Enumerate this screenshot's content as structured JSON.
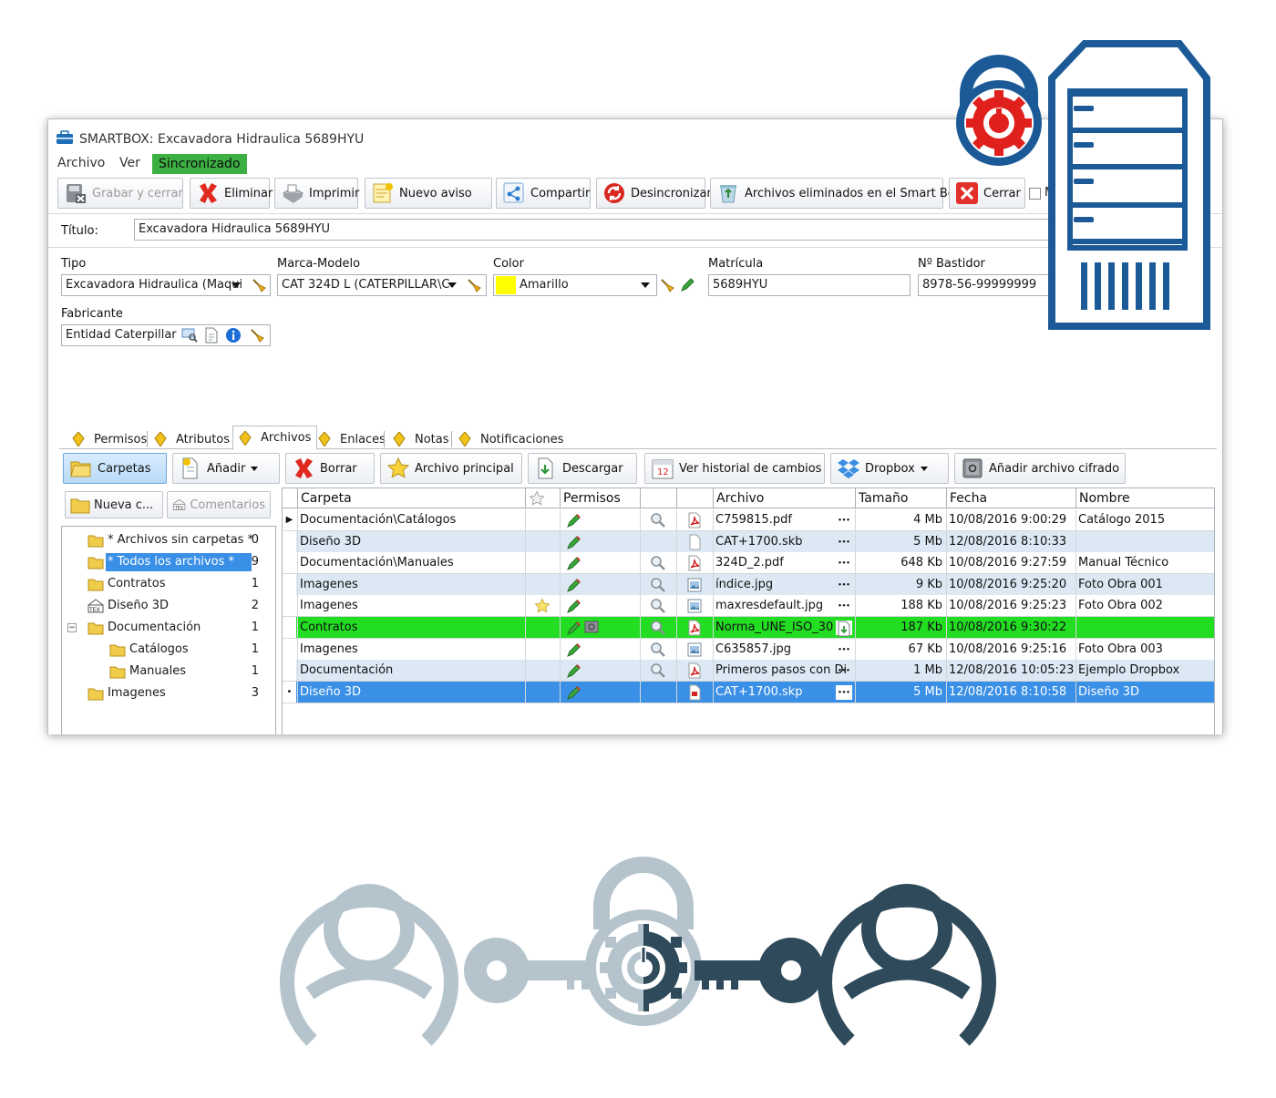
{
  "window": {
    "title": "SMARTBOX: Excavadora Hidraulica 5689HYU",
    "menu": [
      "Archivo",
      "Ver"
    ],
    "sync_label": "Sincronizado"
  },
  "toolbar": {
    "grabar": "Grabar y cerrar",
    "eliminar": "Eliminar",
    "imprimir": "Imprimir",
    "nuevo_aviso": "Nuevo aviso",
    "compartir": "Compartir",
    "desincronizar": "Desincronizar",
    "archivos_eliminados": "Archivos eliminados en el Smart Box",
    "cerrar": "Cerrar",
    "cerrar_check": "Ma"
  },
  "form": {
    "titulo_label": "Título:",
    "titulo_value": "Excavadora Hidraulica 5689HYU",
    "tipo_label": "Tipo",
    "tipo_value": "Excavadora Hidraulica (Maqui",
    "marca_label": "Marca-Modelo",
    "marca_value": "CAT 324D L (CATERPILLAR\\C",
    "color_label": "Color",
    "color_value": "Amarillo",
    "color_swatch": "#ffff00",
    "matricula_label": "Matrícula",
    "matricula_value": "5689HYU",
    "bastidor_label": "Nº Bastidor",
    "bastidor_value": "8978-56-99999999",
    "fabricante_label": "Fabricante",
    "fabricante_value": "Entidad Caterpillar"
  },
  "tabs": [
    "Permisos",
    "Atributos",
    "Archivos",
    "Enlaces",
    "Notas",
    "Notificaciones"
  ],
  "toolbar2": {
    "carpetas": "Carpetas",
    "anadir": "Añadir",
    "borrar": "Borrar",
    "archivo_principal": "Archivo principal",
    "descargar": "Descargar",
    "historial": "Ver historial de cambios",
    "dropbox": "Dropbox",
    "cifrado": "Añadir archivo cifrado"
  },
  "folder_buttons": {
    "nueva": "Nueva c...",
    "comentarios": "Comentarios"
  },
  "folders": [
    {
      "name": "* Archivos sin carpetas *",
      "count": "0"
    },
    {
      "name": "* Todos los archivos *",
      "count": "9"
    },
    {
      "name": "Contratos",
      "count": "1"
    },
    {
      "name": "Diseño 3D",
      "count": "2"
    },
    {
      "name": "Documentación",
      "count": "1"
    },
    {
      "name": "Catálogos",
      "count": "1"
    },
    {
      "name": "Manuales",
      "count": "1"
    },
    {
      "name": "Imagenes",
      "count": "3"
    }
  ],
  "grid": {
    "headers": {
      "carpeta": "Carpeta",
      "permisos": "Permisos",
      "archivo": "Archivo",
      "tamano": "Tamaño",
      "fecha": "Fecha",
      "nombre": "Nombre"
    },
    "rows": [
      {
        "carpeta": "Documentación\\Catálogos",
        "archivo": "C759815.pdf",
        "tamano": "4 Mb",
        "fecha": "10/08/2016 9:00:29",
        "nombre": "Catálogo 2015"
      },
      {
        "carpeta": "Diseño 3D",
        "archivo": "CAT+1700.skb",
        "tamano": "5 Mb",
        "fecha": "12/08/2016 8:10:33",
        "nombre": ""
      },
      {
        "carpeta": "Documentación\\Manuales",
        "archivo": "324D_2.pdf",
        "tamano": "648 Kb",
        "fecha": "10/08/2016 9:27:59",
        "nombre": "Manual Técnico"
      },
      {
        "carpeta": "Imagenes",
        "archivo": "índice.jpg",
        "tamano": "9 Kb",
        "fecha": "10/08/2016 9:25:20",
        "nombre": "Foto Obra 001"
      },
      {
        "carpeta": "Imagenes",
        "archivo": "maxresdefault.jpg",
        "tamano": "188 Kb",
        "fecha": "10/08/2016 9:25:23",
        "nombre": "Foto Obra 002"
      },
      {
        "carpeta": "Contratos",
        "archivo": "Norma_UNE_ISO_30",
        "tamano": "187 Kb",
        "fecha": "10/08/2016 9:30:22",
        "nombre": ""
      },
      {
        "carpeta": "Imagenes",
        "archivo": "C635857.jpg",
        "tamano": "67 Kb",
        "fecha": "10/08/2016 9:25:16",
        "nombre": "Foto Obra 003"
      },
      {
        "carpeta": "Documentación",
        "archivo": "Primeros pasos con Di",
        "tamano": "1 Mb",
        "fecha": "12/08/2016 10:05:23",
        "nombre": "Ejemplo Dropbox"
      },
      {
        "carpeta": "Diseño 3D",
        "archivo": "CAT+1700.skp",
        "tamano": "5 Mb",
        "fecha": "12/08/2016 8:10:58",
        "nombre": "Diseño 3D"
      }
    ]
  },
  "colors": {
    "accent_blue": "#1c5a97",
    "lock_red": "#e0201c",
    "row_green": "#22dd22",
    "row_selected": "#3a8fe6",
    "row_alt": "#dce9f4",
    "user_light": "#b5c4cc",
    "user_dark": "#2f4a5a"
  },
  "icons": {
    "secure_server": "server-lock-icon",
    "key_exchange": "user-key-lock-icon"
  }
}
